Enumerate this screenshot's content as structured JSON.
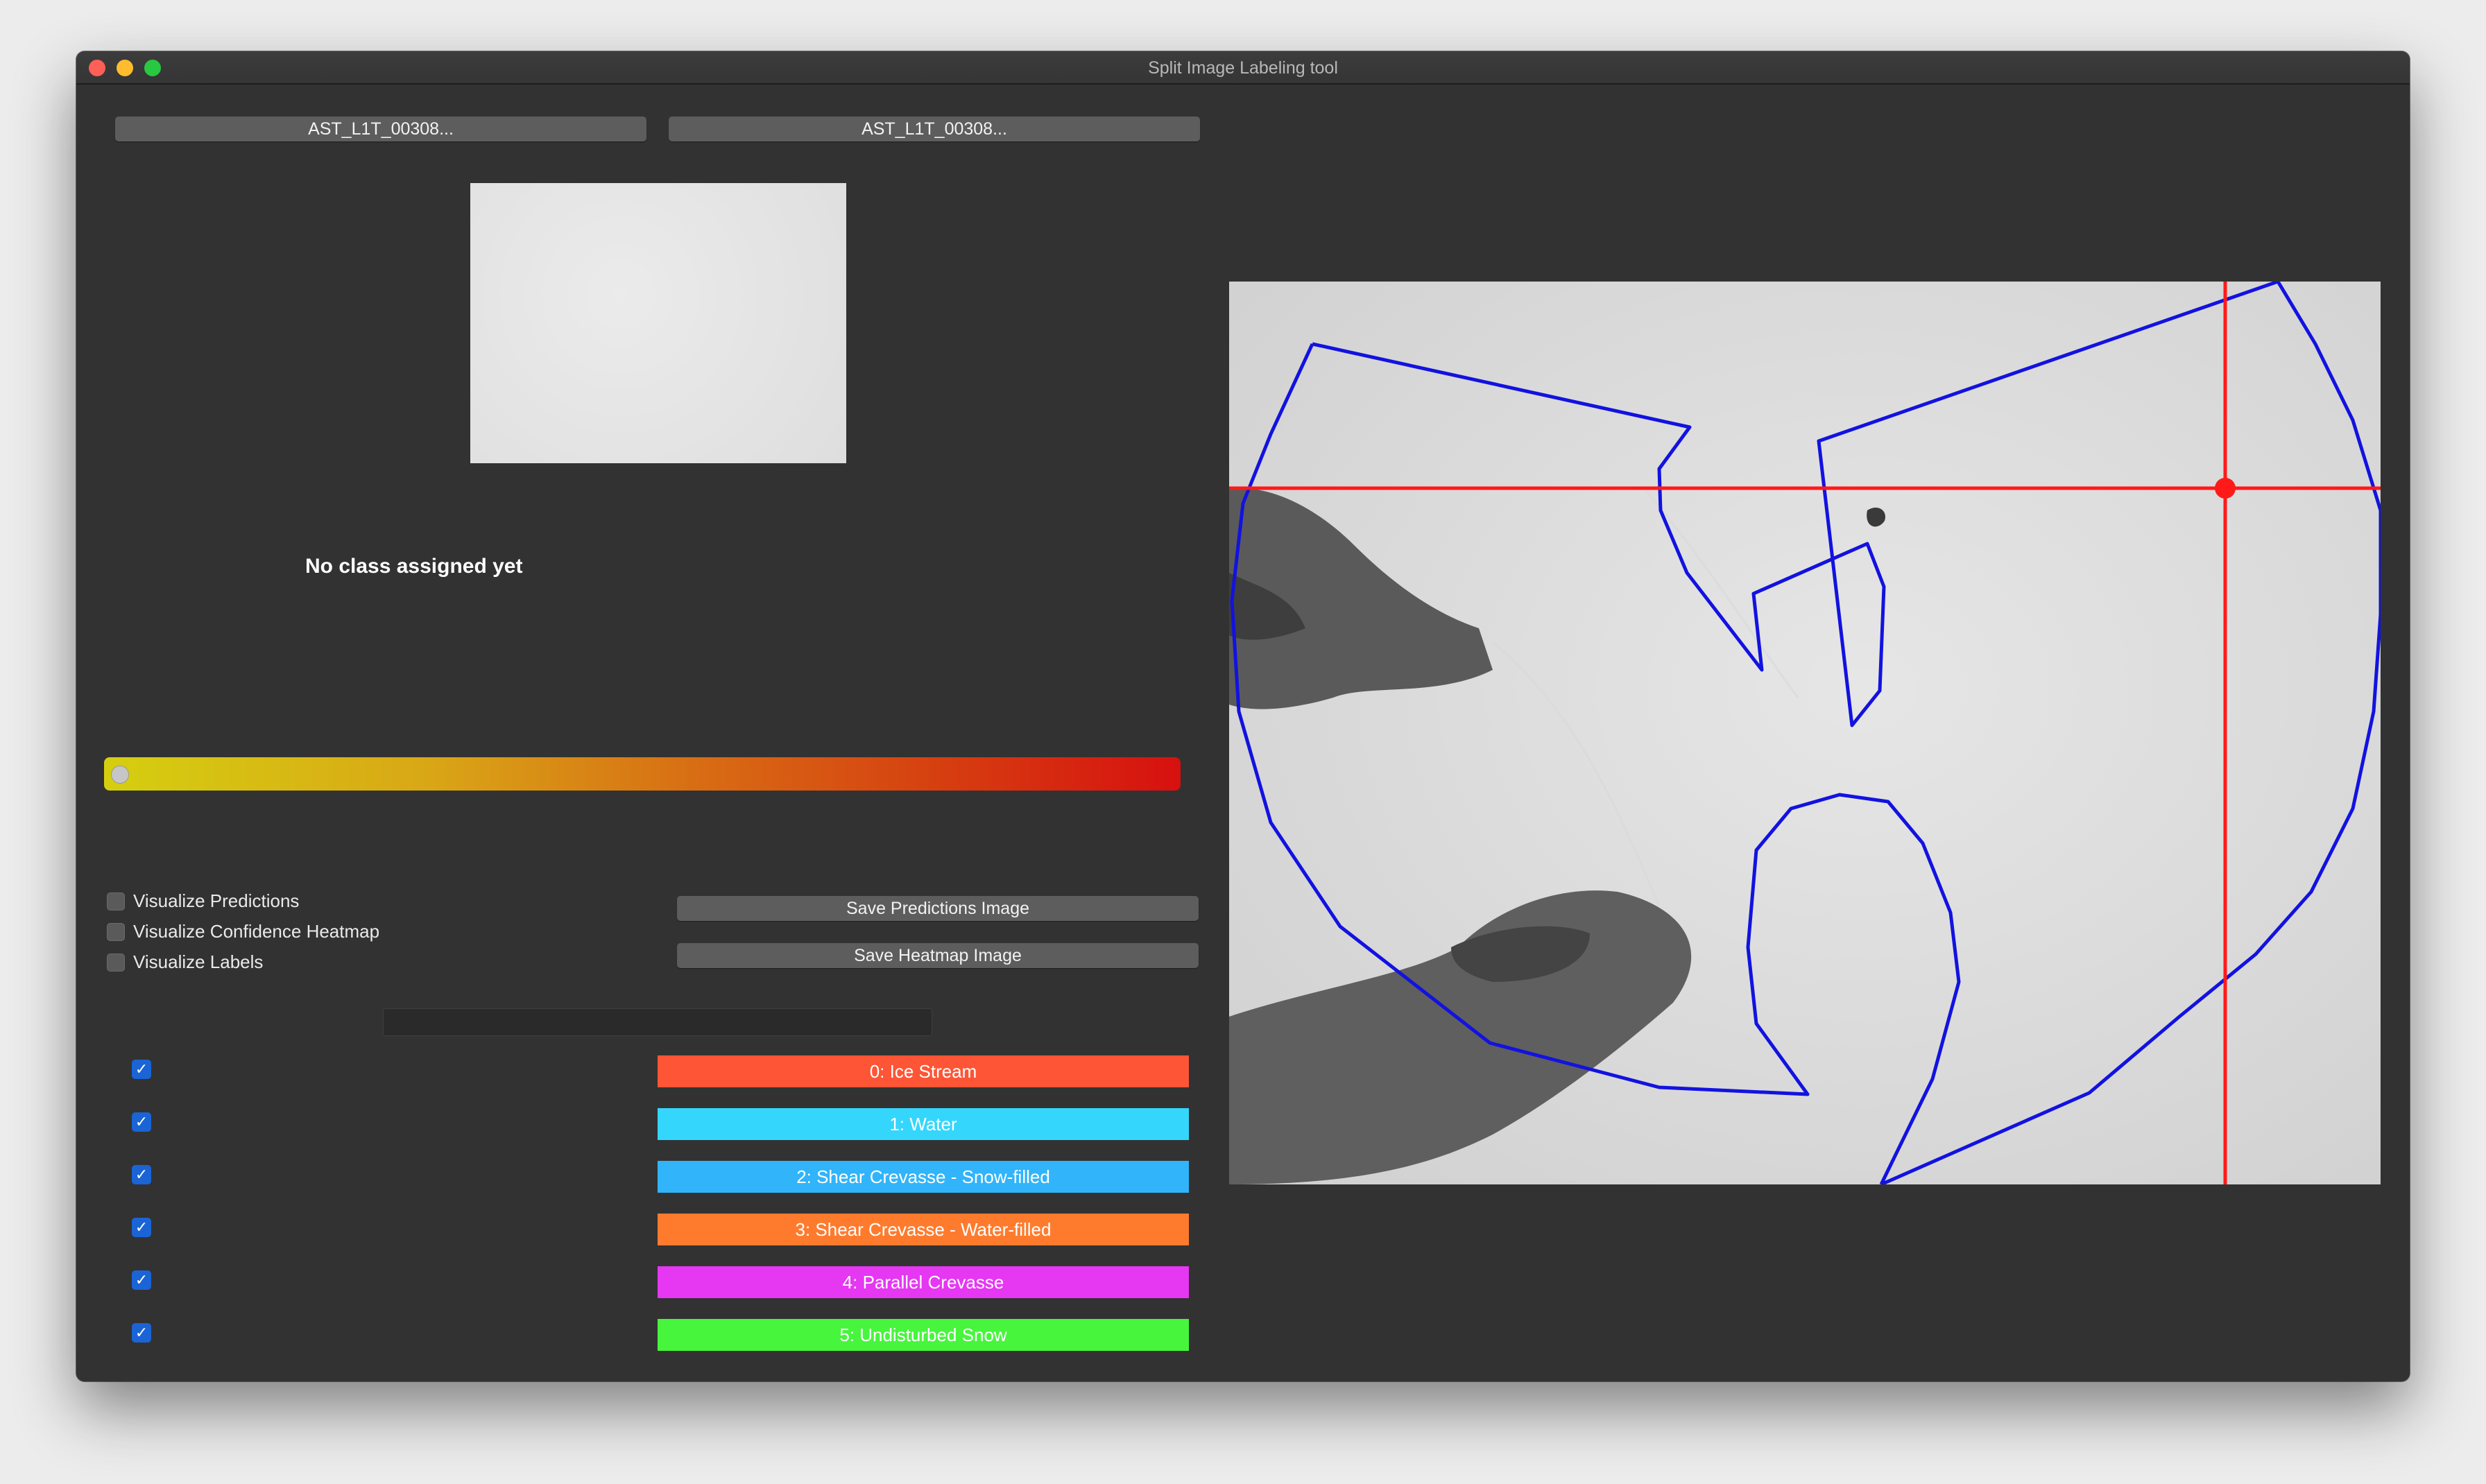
{
  "window": {
    "title": "Split Image Labeling tool"
  },
  "files": {
    "left_label": "AST_L1T_00308...",
    "right_label": "AST_L1T_00308..."
  },
  "status": {
    "text": "No class assigned yet"
  },
  "confidence_slider": {
    "value": 0
  },
  "visualize": [
    {
      "label": "Visualize Predictions",
      "checked": false
    },
    {
      "label": "Visualize Confidence Heatmap",
      "checked": false
    },
    {
      "label": "Visualize Labels",
      "checked": false
    }
  ],
  "actions": {
    "save_predictions": "Save Predictions Image",
    "save_heatmap": "Save Heatmap Image"
  },
  "classes": [
    {
      "label": "0: Ice Stream",
      "color": "#fd5535",
      "checked": true
    },
    {
      "label": "1: Water",
      "color": "#34d6fc",
      "checked": true
    },
    {
      "label": "2: Shear Crevasse - Snow-filled",
      "color": "#31b4fa",
      "checked": true
    },
    {
      "label": "3: Shear Crevasse - Water-filled",
      "color": "#fe7b2e",
      "checked": true
    },
    {
      "label": "4: Parallel Crevasse",
      "color": "#e637f3",
      "checked": true
    },
    {
      "label": "5: Undisturbed Snow",
      "color": "#47f53d",
      "checked": true
    }
  ],
  "overlay": {
    "polygon_color": "#1212e0",
    "crosshair_color": "#ff1a1a"
  }
}
